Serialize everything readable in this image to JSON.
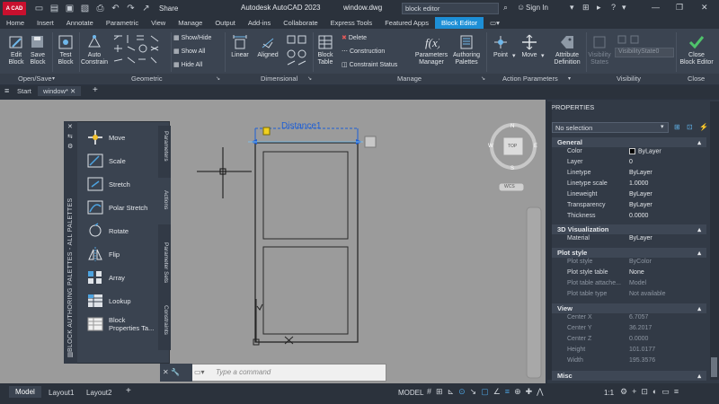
{
  "titlebar": {
    "logo": "A CAD",
    "share": "Share",
    "app_title": "Autodesk AutoCAD 2023",
    "doc_name": "window.dwg",
    "search_value": "block editor",
    "signin": "Sign In"
  },
  "menu": [
    "Home",
    "Insert",
    "Annotate",
    "Parametric",
    "View",
    "Manage",
    "Output",
    "Add-ins",
    "Collaborate",
    "Express Tools",
    "Featured Apps",
    "Block Editor"
  ],
  "ribbon": {
    "edit_block": "Edit\nBlock",
    "save_block": "Save\nBlock",
    "test_block": "Test\nBlock",
    "auto_constrain": "Auto\nConstrain",
    "show_hide": "Show/Hide",
    "show_all": "Show All",
    "hide_all": "Hide All",
    "linear": "Linear",
    "aligned": "Aligned",
    "block_table": "Block\nTable",
    "delete": "Delete",
    "construction": "Construction",
    "constraint_status": "Constraint Status",
    "parameters_manager": "Parameters\nManager",
    "authoring_palettes": "Authoring\nPalettes",
    "point": "Point",
    "move": "Move",
    "attribute_definition": "Attribute\nDefinition",
    "visibility_states": "Visibility\nStates",
    "visibility_state_value": "VisibilityState0",
    "close_block_editor": "Close\nBlock Editor",
    "panels": [
      "Open/Save",
      "Geometric",
      "Dimensional",
      "Manage",
      "Action Parameters",
      "Visibility",
      "Close"
    ]
  },
  "doctabs": {
    "start": "Start",
    "active": "window*"
  },
  "palette": {
    "vertical_title": "BLOCK AUTHORING PALETTES - ALL PALETTES",
    "items": [
      "Move",
      "Scale",
      "Stretch",
      "Polar Stretch",
      "Rotate",
      "Flip",
      "Array",
      "Lookup",
      "Block\nProperties Ta..."
    ],
    "tabs": [
      "Parameters",
      "Actions",
      "Parameter Sets",
      "Constraints"
    ]
  },
  "canvas": {
    "dimension_label": "Distance1",
    "viewcube": {
      "n": "N",
      "s": "S",
      "w": "W",
      "e": "E",
      "top": "TOP",
      "wcs": "WCS"
    }
  },
  "command": {
    "placeholder": "Type a command"
  },
  "properties": {
    "title": "PROPERTIES",
    "selection": "No selection",
    "sections": {
      "general": "General",
      "viz3d": "3D Visualization",
      "plot_style": "Plot style",
      "view": "View",
      "misc": "Misc"
    },
    "general": [
      {
        "k": "Color",
        "v": "ByLayer"
      },
      {
        "k": "Layer",
        "v": "0"
      },
      {
        "k": "Linetype",
        "v": "ByLayer"
      },
      {
        "k": "Linetype scale",
        "v": "1.0000"
      },
      {
        "k": "Lineweight",
        "v": "ByLayer"
      },
      {
        "k": "Transparency",
        "v": "ByLayer"
      },
      {
        "k": "Thickness",
        "v": "0.0000"
      }
    ],
    "viz3d": [
      {
        "k": "Material",
        "v": "ByLayer"
      }
    ],
    "plot": [
      {
        "k": "Plot style",
        "v": "ByColor"
      },
      {
        "k": "Plot style table",
        "v": "None"
      },
      {
        "k": "Plot table attache...",
        "v": "Model"
      },
      {
        "k": "Plot table type",
        "v": "Not available"
      }
    ],
    "view": [
      {
        "k": "Center X",
        "v": "6.7057"
      },
      {
        "k": "Center Y",
        "v": "36.2017"
      },
      {
        "k": "Center Z",
        "v": "0.0000"
      },
      {
        "k": "Height",
        "v": "101.0177"
      },
      {
        "k": "Width",
        "v": "195.3576"
      }
    ]
  },
  "status": {
    "model_tab": "Model",
    "layout1": "Layout1",
    "layout2": "Layout2",
    "model": "MODEL",
    "scale": "1:1"
  }
}
